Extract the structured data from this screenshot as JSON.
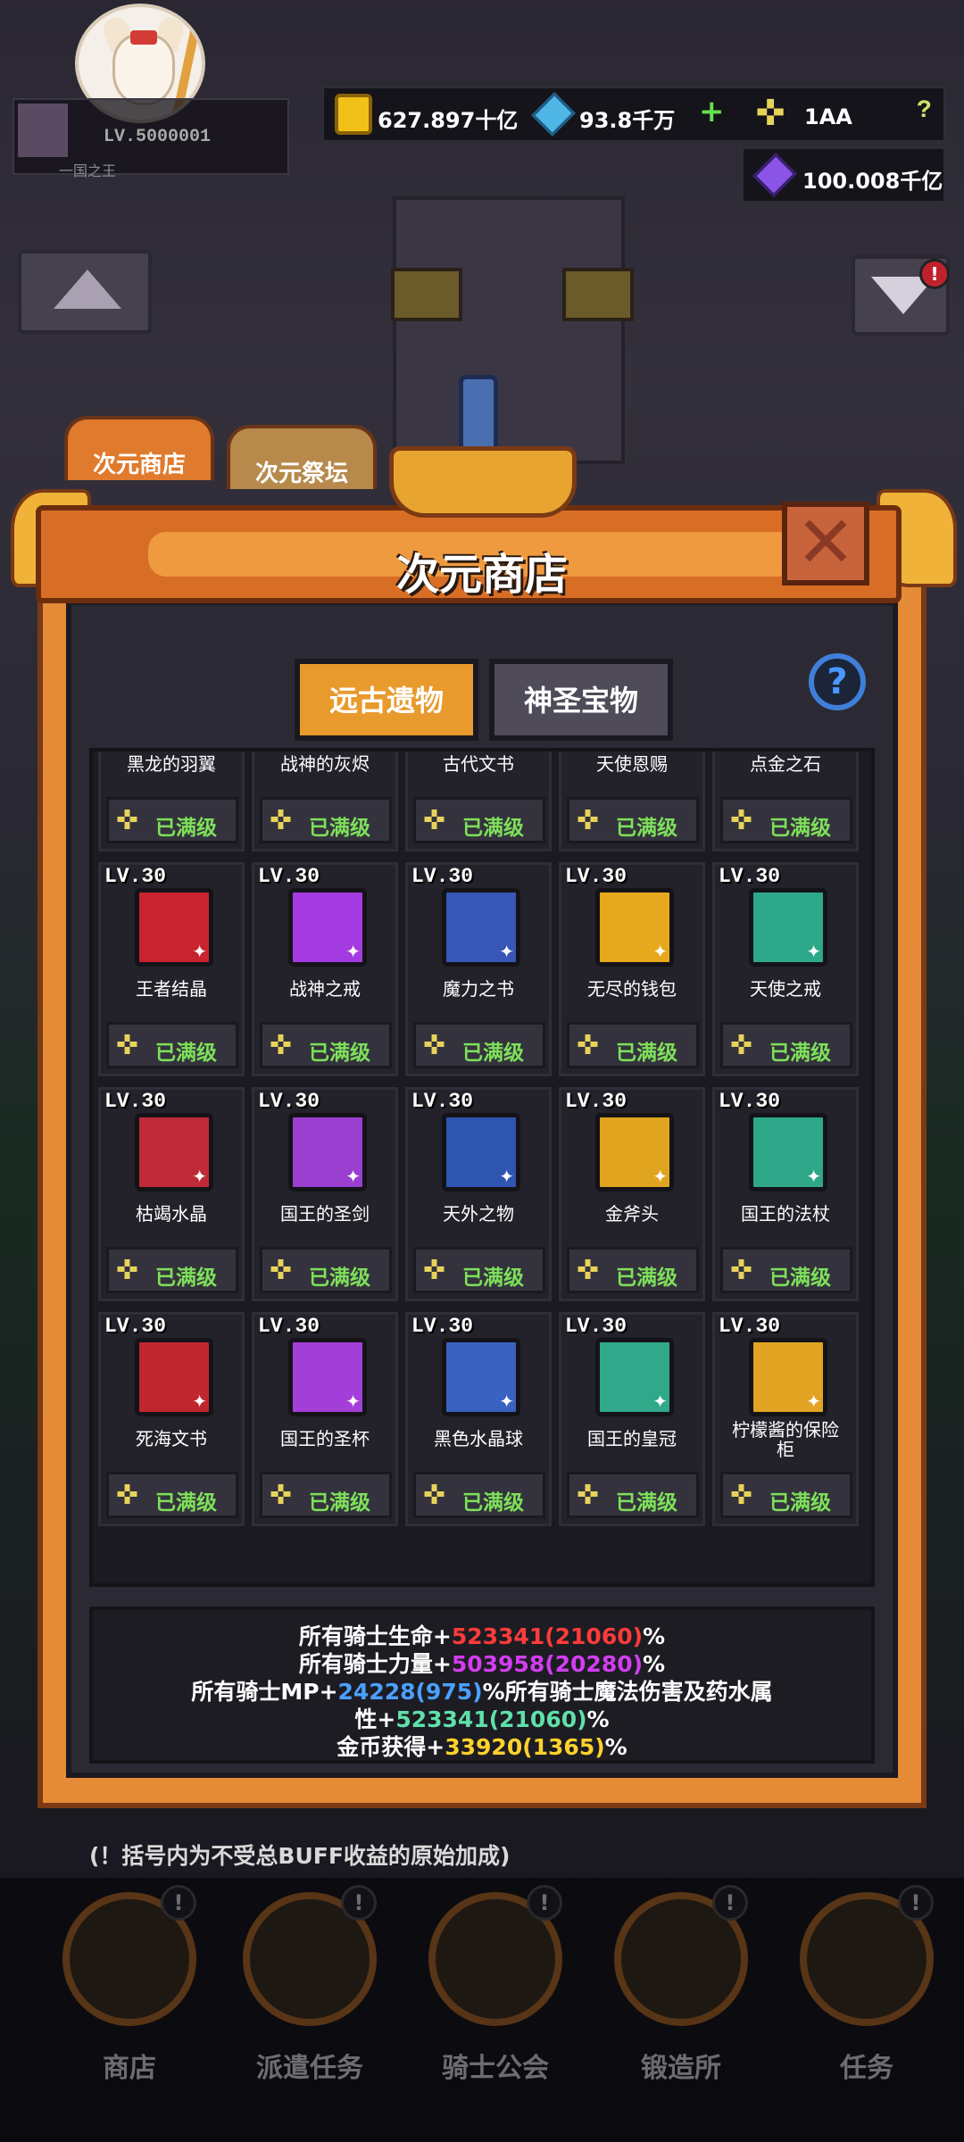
{
  "player": {
    "level": "LV.5000001",
    "title": "一国之王"
  },
  "resources": {
    "gold": "627.897十亿",
    "diamond": "93.8千万",
    "star": "1AA",
    "crystal": "100.008千亿"
  },
  "outer_tabs": [
    {
      "label": "次元商店"
    },
    {
      "label": "次元祭坛"
    }
  ],
  "panel": {
    "title": "次元商店"
  },
  "inner_tabs": [
    {
      "label": "远古遗物"
    },
    {
      "label": "神圣宝物"
    }
  ],
  "max_label": "已满级",
  "items_top_row": [
    {
      "name": "黑龙的羽翼"
    },
    {
      "name": "战神的灰烬"
    },
    {
      "name": "古代文书"
    },
    {
      "name": "天使恩赐"
    },
    {
      "name": "点金之石"
    }
  ],
  "items": [
    {
      "level": "LV.30",
      "name": "王者结晶",
      "color": "#c7242f"
    },
    {
      "level": "LV.30",
      "name": "战神之戒",
      "color": "#a43be0"
    },
    {
      "level": "LV.30",
      "name": "魔力之书",
      "color": "#3856b8"
    },
    {
      "level": "LV.30",
      "name": "无尽的钱包",
      "color": "#e6a81c"
    },
    {
      "level": "LV.30",
      "name": "天使之戒",
      "color": "#2ea88a"
    },
    {
      "level": "LV.30",
      "name": "枯竭水晶",
      "color": "#c02a38"
    },
    {
      "level": "LV.30",
      "name": "国王的圣剑",
      "color": "#9a3fd0"
    },
    {
      "level": "LV.30",
      "name": "天外之物",
      "color": "#2e56b0"
    },
    {
      "level": "LV.30",
      "name": "金斧头",
      "color": "#e0a41e"
    },
    {
      "level": "LV.30",
      "name": "国王的法杖",
      "color": "#2ea888"
    },
    {
      "level": "LV.30",
      "name": "死海文书",
      "color": "#c0262e"
    },
    {
      "level": "LV.30",
      "name": "国王的圣杯",
      "color": "#a43ed8"
    },
    {
      "level": "LV.30",
      "name": "黑色水晶球",
      "color": "#3a62c0"
    },
    {
      "level": "LV.30",
      "name": "国王的皇冠",
      "color": "#30a88a"
    },
    {
      "level": "LV.30",
      "name": "柠檬酱的保险柜",
      "color": "#e2a422"
    }
  ],
  "stats": {
    "l1_pre": "所有骑士生命+",
    "l1_val": "523341(21060)",
    "l1_suf": "%",
    "l2_pre": "所有骑士力量+",
    "l2_val": "503958(20280)",
    "l2_suf": "%",
    "l3_pre": "所有骑士MP+",
    "l3_val": "24228(975)",
    "l3_suf": "%所有骑士魔法伤害及药水属",
    "l4_pre": "性+",
    "l4_val": "523341(21060)",
    "l4_suf": "%",
    "l5_pre": "金币获得+",
    "l5_val": "33920(1365)",
    "l5_suf": "%"
  },
  "note": "(！括号内为不受总BUFF收益的原始加成)",
  "nav": [
    {
      "label": "商店",
      "icon": "shop-icon"
    },
    {
      "label": "派遣任务",
      "icon": "dispatch-icon"
    },
    {
      "label": "骑士公会",
      "icon": "guild-icon"
    },
    {
      "label": "锻造所",
      "icon": "anvil-icon"
    },
    {
      "label": "任务",
      "icon": "quest-icon"
    }
  ],
  "colors": {
    "panel": "#e58a37",
    "accent": "#7ee05a",
    "hp": "#ff3b3b",
    "str": "#d33df0",
    "mp": "#4aa0ff",
    "gold": "#ffd22c"
  }
}
